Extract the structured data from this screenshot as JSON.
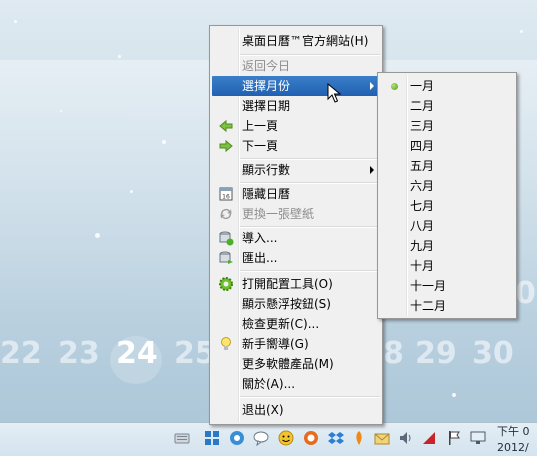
{
  "desktop": {
    "days": [
      "22",
      "23",
      "24",
      "25",
      "8",
      "29",
      "30"
    ],
    "today": "24",
    "partial_digit": "0"
  },
  "taskbar": {
    "clock_time": "下午 0",
    "clock_date": "2012/"
  },
  "context_menu": {
    "items": [
      {
        "label": "桌面日曆™官方網站(H)",
        "icon": ""
      },
      {
        "label": "返回今日",
        "disabled": true
      },
      {
        "label": "選擇月份",
        "highlighted": true,
        "submenu": true
      },
      {
        "label": "選擇日期"
      },
      {
        "label": "上一頁",
        "icon": "arrow-left-icon"
      },
      {
        "label": "下一頁",
        "icon": "arrow-right-icon"
      },
      {
        "label": "顯示行數",
        "submenu": true
      },
      {
        "label": "隱藏日曆",
        "icon": "calendar-icon"
      },
      {
        "label": "更換一張壁紙",
        "icon": "refresh-icon",
        "disabled": true
      },
      {
        "label": "導入...",
        "icon": "import-icon"
      },
      {
        "label": "匯出...",
        "icon": "export-icon"
      },
      {
        "label": "打開配置工具(O)",
        "icon": "gear-icon"
      },
      {
        "label": "顯示懸浮按鈕(S)"
      },
      {
        "label": "檢查更新(C)..."
      },
      {
        "label": "新手嚮導(G)",
        "icon": "lightbulb-icon"
      },
      {
        "label": "更多軟體產品(M)"
      },
      {
        "label": "關於(A)..."
      },
      {
        "label": "退出(X)"
      }
    ]
  },
  "month_submenu": {
    "selected": "一月",
    "months": [
      "一月",
      "二月",
      "三月",
      "四月",
      "五月",
      "六月",
      "七月",
      "八月",
      "九月",
      "十月",
      "十一月",
      "十二月"
    ]
  }
}
